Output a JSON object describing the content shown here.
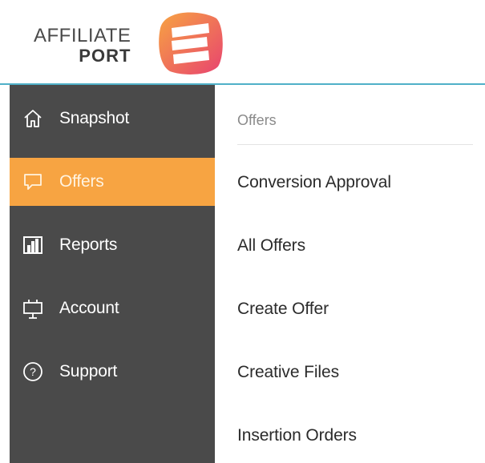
{
  "brand": {
    "line1": "AFFILIATE",
    "line2": "PORT",
    "colors": {
      "orange": "#f7a442",
      "pink": "#e8436f"
    }
  },
  "sidebar": {
    "background": "#4a4a4a",
    "active_color": "#f7a442",
    "items": [
      {
        "label": "Snapshot",
        "icon": "home-icon",
        "active": false
      },
      {
        "label": "Offers",
        "icon": "speech-bubble-icon",
        "active": true
      },
      {
        "label": "Reports",
        "icon": "bar-chart-icon",
        "active": false
      },
      {
        "label": "Account",
        "icon": "easel-icon",
        "active": false
      },
      {
        "label": "Support",
        "icon": "question-circle-icon",
        "active": false
      }
    ]
  },
  "submenu": {
    "title": "Offers",
    "items": [
      {
        "label": "Conversion Approval"
      },
      {
        "label": "All Offers"
      },
      {
        "label": "Create Offer"
      },
      {
        "label": "Creative Files"
      },
      {
        "label": "Insertion Orders"
      }
    ]
  }
}
